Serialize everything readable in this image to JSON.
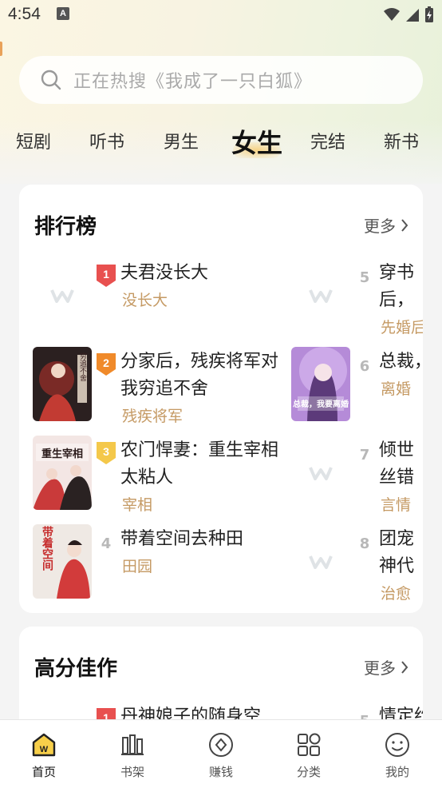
{
  "status_bar": {
    "time": "4:54",
    "notification_letter": "A"
  },
  "search": {
    "placeholder": "正在热搜《我成了一只白狐》"
  },
  "tabs": [
    "短剧",
    "听书",
    "男生",
    "女生",
    "完结",
    "新书"
  ],
  "active_tab": "女生",
  "ranking": {
    "title": "排行榜",
    "more": "更多",
    "books": [
      {
        "rank": "1",
        "title": "夫君没长大",
        "tag": "没长大",
        "cover": "placeholder"
      },
      {
        "rank": "2",
        "title": "分家后，残疾将军对我穷追不舍",
        "tag": "残疾将军",
        "cover": "image"
      },
      {
        "rank": "3",
        "title": "农门悍妻：重生宰相太粘人",
        "tag": "宰相",
        "cover": "image"
      },
      {
        "rank": "4",
        "title": "带着空间去种田",
        "tag": "田园",
        "cover": "image"
      },
      {
        "rank": "5",
        "title": "穿书后，爷的掌",
        "tag": "先婚后",
        "cover": "placeholder"
      },
      {
        "rank": "6",
        "title": "总裁，",
        "tag": "离婚",
        "cover": "image"
      },
      {
        "rank": "7",
        "title": "倾世丝错嫁",
        "tag": "言情",
        "cover": "placeholder"
      },
      {
        "rank": "8",
        "title": "团宠神代",
        "tag": "治愈",
        "cover": "placeholder"
      }
    ]
  },
  "high_score": {
    "title": "高分佳作",
    "more": "更多",
    "books": [
      {
        "rank": "1",
        "title": "丹神娘子的随身空"
      },
      {
        "rank": "5",
        "title": "情定约"
      }
    ]
  },
  "cover_texts": {
    "book2": "穷追不舍",
    "book3": "重生宰相",
    "book4": "带着空间",
    "book6": "总裁，我要离婚"
  },
  "bottom_nav": [
    {
      "label": "首页",
      "icon": "home-icon",
      "active": true
    },
    {
      "label": "书架",
      "icon": "bookshelf-icon",
      "active": false
    },
    {
      "label": "赚钱",
      "icon": "earn-icon",
      "active": false
    },
    {
      "label": "分类",
      "icon": "category-icon",
      "active": false
    },
    {
      "label": "我的",
      "icon": "profile-icon",
      "active": false
    }
  ],
  "colors": {
    "accent_gold": "#c59a64",
    "rank1": "#e8504f",
    "rank2": "#f08a2a",
    "rank3": "#f4c84a"
  }
}
